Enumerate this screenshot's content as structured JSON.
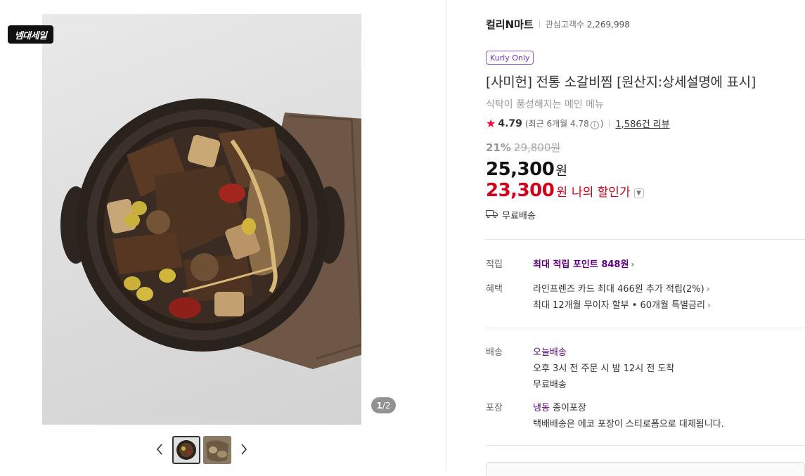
{
  "gallery": {
    "sale_badge": "넴대세일",
    "counter_current": "1",
    "counter_total": "/2",
    "prev_icon": "chevron-left-icon",
    "next_icon": "chevron-right-icon"
  },
  "store": {
    "name": "컬리N마트",
    "fans_label": "관심고객수",
    "fans_count": "2,269,998"
  },
  "product": {
    "badge": "Kurly Only",
    "title": "[사미헌] 전통 소갈비찜 [원산지:상세설명에 표시]",
    "subtitle": "식탁이 풍성해지는 메인 메뉴",
    "rating": "4.79",
    "rating_recent": "(최근 6개월 4.78",
    "rating_recent_close": ")",
    "reviews": "1,586건 리뷰",
    "discount_rate": "21%",
    "original_price": "29,800원",
    "price": "25,300",
    "price_unit": "원",
    "my_price": "23,300",
    "my_price_unit": "원",
    "my_price_label": "나의 할인가",
    "shipping_free": "무료배송"
  },
  "details": {
    "points_label": "적립",
    "points_value_prefix": "최대 적립 포인트",
    "points_value": "848원",
    "benefit_label": "혜택",
    "benefit_line1": "라인프렌즈 카드 최대 466원 추가 적립(2%)",
    "benefit_line2": "최대 12개월 무이자 할부 • 60개월 특별금리",
    "delivery_label": "배송",
    "delivery_type": "오늘배송",
    "delivery_line1": "오후 3시 전 주문 시 밤 12시 전 도착",
    "delivery_line2": "무료배송",
    "packaging_label": "포장",
    "packaging_type": "냉동",
    "packaging_type_rest": " 종이포장",
    "packaging_line": "택배배송은 에코 포장이 스티로폼으로 대체됩니다."
  },
  "colors": {
    "accent_purple": "#5f0080",
    "discount_red": "#d6001c",
    "star_red": "#ff0033"
  }
}
